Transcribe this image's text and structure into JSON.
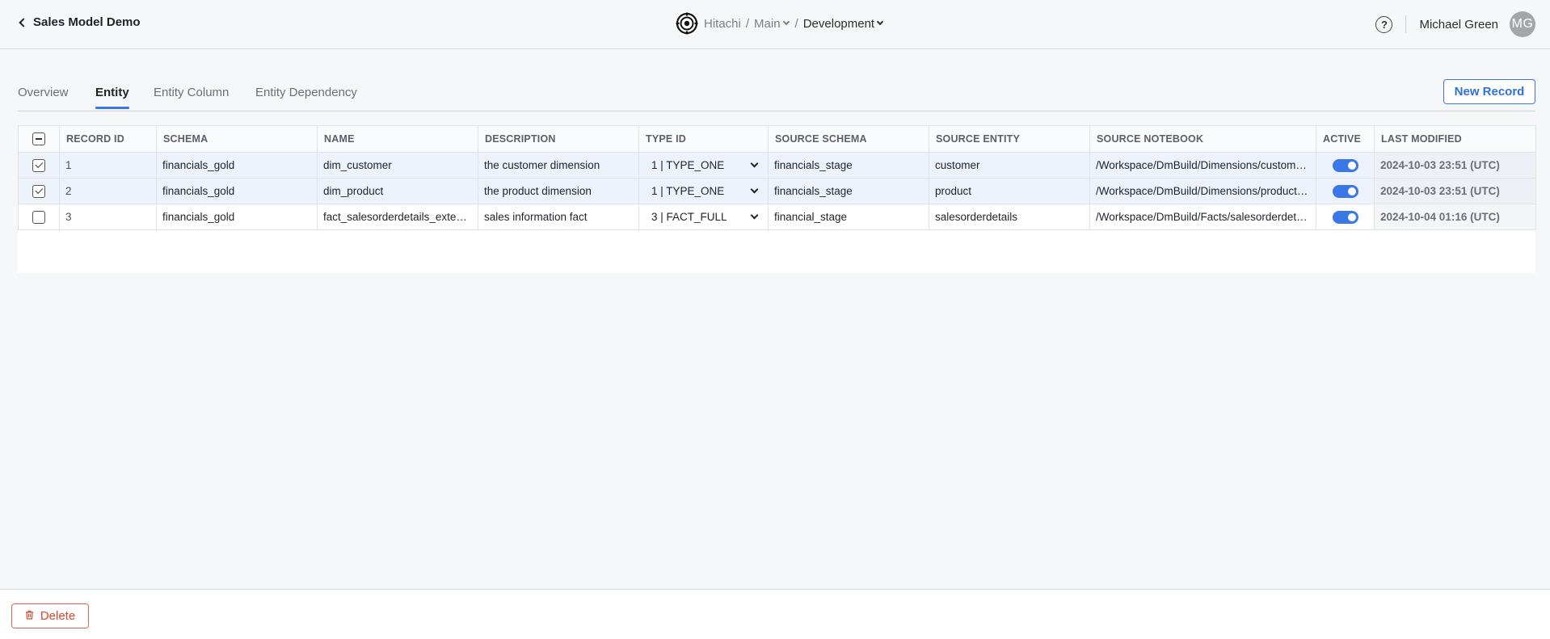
{
  "header": {
    "back_title": "Sales Model Demo",
    "org": "Hitachi",
    "sep1": "/",
    "branch": "Main",
    "sep2": "/",
    "env": "Development",
    "help_glyph": "?",
    "user_name": "Michael Green",
    "user_initials": "MG"
  },
  "tabs": [
    {
      "label": "Overview"
    },
    {
      "label": "Entity"
    },
    {
      "label": "Entity Column"
    },
    {
      "label": "Entity Dependency"
    }
  ],
  "new_record_label": "New Record",
  "table": {
    "columns": [
      "RECORD ID",
      "SCHEMA",
      "NAME",
      "DESCRIPTION",
      "TYPE ID",
      "SOURCE SCHEMA",
      "SOURCE ENTITY",
      "SOURCE NOTEBOOK",
      "ACTIVE",
      "LAST MODIFIED"
    ],
    "rows": [
      {
        "selected": true,
        "record_id": "1",
        "schema": "financials_gold",
        "name": "dim_customer",
        "description": "the customer dimension",
        "type_id": "1 | TYPE_ONE",
        "source_schema": "financials_stage",
        "source_entity": "customer",
        "source_notebook": "/Workspace/DmBuild/Dimensions/customer_dimension",
        "active": true,
        "last_modified": "2024-10-03 23:51 (UTC)"
      },
      {
        "selected": true,
        "record_id": "2",
        "schema": "financials_gold",
        "name": "dim_product",
        "description": "the product dimension",
        "type_id": "1 | TYPE_ONE",
        "source_schema": "financials_stage",
        "source_entity": "product",
        "source_notebook": "/Workspace/DmBuild/Dimensions/product_dimension",
        "active": true,
        "last_modified": "2024-10-03 23:51 (UTC)"
      },
      {
        "selected": false,
        "record_id": "3",
        "schema": "financials_gold",
        "name": "fact_salesorderdetails_extended",
        "description": "sales information fact",
        "type_id": "3 | FACT_FULL",
        "source_schema": "financial_stage",
        "source_entity": "salesorderdetails",
        "source_notebook": "/Workspace/DmBuild/Facts/salesorderdetails_fact",
        "active": true,
        "last_modified": "2024-10-04 01:16 (UTC)"
      }
    ]
  },
  "footer": {
    "delete_label": "Delete"
  },
  "colors": {
    "accent": "#3b78e7",
    "danger": "#e0442c",
    "selected_row": "#eef3fb"
  }
}
